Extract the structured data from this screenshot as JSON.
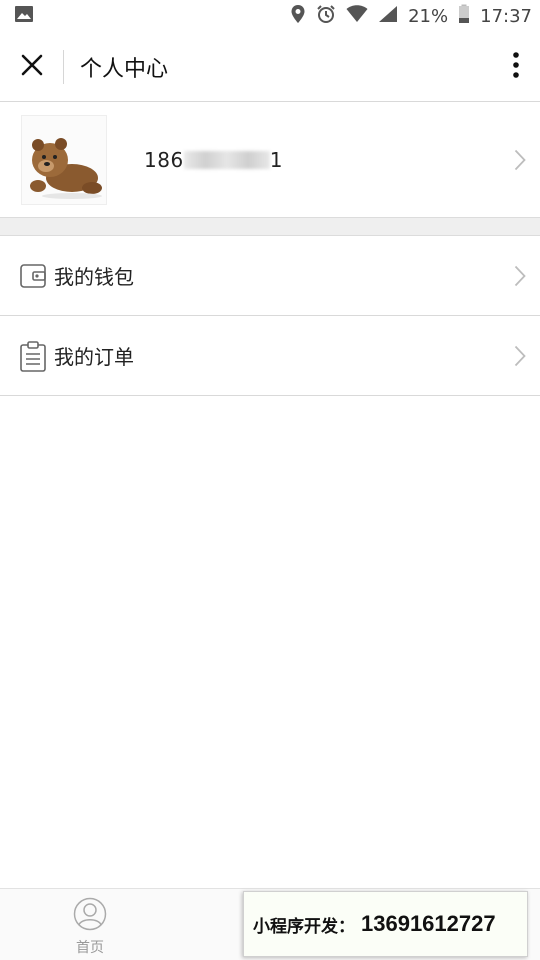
{
  "status_bar": {
    "battery": "21%",
    "time": "17:37",
    "icons": [
      "image-icon",
      "location-icon",
      "alarm-icon",
      "wifi-icon",
      "signal-icon",
      "battery-icon"
    ]
  },
  "nav": {
    "title": "个人中心",
    "close_icon": "close-icon",
    "more_icon": "more-vertical-icon"
  },
  "profile": {
    "phone_prefix": "186",
    "phone_suffix": "1",
    "avatar_icon": "teddy-bear-avatar"
  },
  "menu": {
    "items": [
      {
        "label": "我的钱包",
        "icon": "wallet-icon"
      },
      {
        "label": "我的订单",
        "icon": "clipboard-icon"
      }
    ]
  },
  "tabbar": {
    "tabs": [
      {
        "label": "首页",
        "icon": "user-circle-icon"
      }
    ]
  },
  "promo": {
    "label": "小程序开发：",
    "number": "13691612727"
  },
  "colors": {
    "divider": "#d9d9d9",
    "section_gap": "#efefef",
    "tab_label": "#999999",
    "chevron": "#bdbdbd"
  }
}
